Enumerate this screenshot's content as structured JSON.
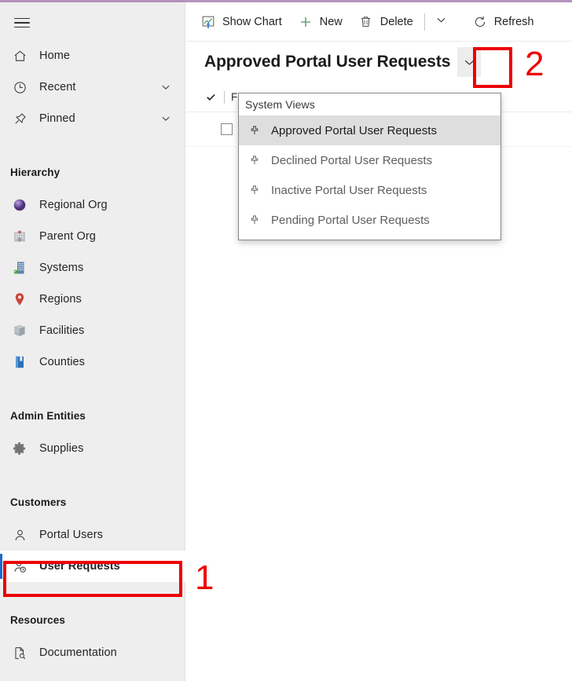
{
  "theme": {
    "accent_top": "#b592bd",
    "sidebar_bg": "#eeeeee",
    "selected_indicator": "#2266cc",
    "annotation_color": "#ee0000",
    "dropdown_highlight": "#dedede"
  },
  "sidebar": {
    "menu_button": "site-map-menu",
    "primary": [
      {
        "label": "Home",
        "icon": "home-icon",
        "expandable": false
      },
      {
        "label": "Recent",
        "icon": "clock-icon",
        "expandable": true
      },
      {
        "label": "Pinned",
        "icon": "pin-icon",
        "expandable": true
      }
    ],
    "groups": [
      {
        "title": "Hierarchy",
        "items": [
          {
            "label": "Regional Org",
            "icon": "globe-sphere-icon"
          },
          {
            "label": "Parent Org",
            "icon": "hospital-icon"
          },
          {
            "label": "Systems",
            "icon": "office-building-icon"
          },
          {
            "label": "Regions",
            "icon": "map-pin-icon"
          },
          {
            "label": "Facilities",
            "icon": "facility-cube-icon"
          },
          {
            "label": "Counties",
            "icon": "book-icon"
          }
        ]
      },
      {
        "title": "Admin Entities",
        "items": [
          {
            "label": "Supplies",
            "icon": "gear-icon"
          }
        ]
      },
      {
        "title": "Customers",
        "items": [
          {
            "label": "Portal Users",
            "icon": "person-icon"
          },
          {
            "label": "User Requests",
            "icon": "person-clock-icon",
            "selected": true
          }
        ]
      },
      {
        "title": "Resources",
        "items": [
          {
            "label": "Documentation",
            "icon": "document-search-icon"
          }
        ]
      }
    ]
  },
  "commandbar": {
    "items": [
      {
        "label": "Show Chart",
        "icon": "show-chart-icon"
      },
      {
        "label": "New",
        "icon": "plus-icon"
      },
      {
        "label": "Delete",
        "icon": "trash-icon"
      }
    ],
    "overflow": "chevron-down-icon",
    "refresh": {
      "label": "Refresh",
      "icon": "refresh-icon"
    }
  },
  "view": {
    "title": "Approved Portal User Requests",
    "selector_icon": "chevron-down-icon"
  },
  "grid": {
    "select_all_icon": "checkmark-icon",
    "first_column_header": "F",
    "row_checkbox": "row-select-checkbox"
  },
  "dropdown": {
    "header": "System Views",
    "items": [
      {
        "label": "Approved Portal User Requests",
        "icon": "pin-icon",
        "selected": true
      },
      {
        "label": "Declined Portal User Requests",
        "icon": "pin-icon",
        "selected": false
      },
      {
        "label": "Inactive Portal User Requests",
        "icon": "pin-icon",
        "selected": false
      },
      {
        "label": "Pending Portal User Requests",
        "icon": "pin-icon",
        "selected": false
      }
    ]
  },
  "annotations": [
    {
      "number": "1",
      "target": "sidebar-item-user-requests"
    },
    {
      "number": "2",
      "target": "view-selector-chevron"
    }
  ]
}
